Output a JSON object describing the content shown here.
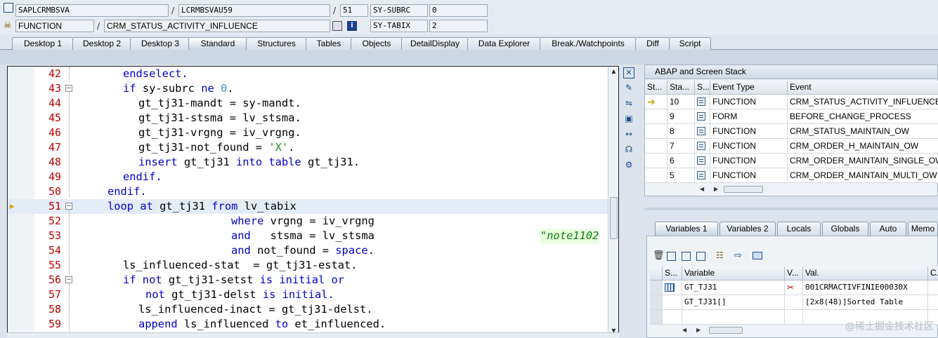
{
  "header": {
    "program": "SAPLCRMBSVA",
    "include": "LCRMBSVAU59",
    "line": "51",
    "sysubrc_label": "SY-SUBRC",
    "sysubrc_value": "0",
    "event_type": "FUNCTION",
    "event": "CRM_STATUS_ACTIVITY_INFLUENCE",
    "sytabix_label": "SY-TABIX",
    "sytabix_value": "2",
    "sep1": "/",
    "sep2": "/"
  },
  "tabs": [
    "Desktop 1",
    "Desktop 2",
    "Desktop 3",
    "Standard",
    "Structures",
    "Tables",
    "Objects",
    "DetailDisplay",
    "Data Explorer",
    "Break./Watchpoints",
    "Diff",
    "Script"
  ],
  "active_tab": "Standard",
  "code": {
    "current_line": "51",
    "lines": [
      {
        "n": "42",
        "t": "endselect."
      },
      {
        "n": "43",
        "t": "if sy-subrc ne 0."
      },
      {
        "n": "44",
        "t": "gt_tj31-mandt = sy-mandt."
      },
      {
        "n": "45",
        "t": "gt_tj31-stsma = lv_stsma."
      },
      {
        "n": "46",
        "t": "gt_tj31-vrgng = iv_vrgng."
      },
      {
        "n": "47",
        "t": "gt_tj31-not_found = 'X'."
      },
      {
        "n": "48",
        "t": "insert gt_tj31 into table gt_tj31."
      },
      {
        "n": "49",
        "t": "endif."
      },
      {
        "n": "50",
        "t": "endif."
      },
      {
        "n": "51",
        "t": "loop at gt_tj31 from lv_tabix"
      },
      {
        "n": "52",
        "t": "where vrgng = iv_vrgng"
      },
      {
        "n": "53",
        "t": "and   stsma = lv_stsma"
      },
      {
        "n": "54",
        "t": "and not_found = space."
      },
      {
        "n": "55",
        "t": "ls_influenced-stat  = gt_tj31-estat."
      },
      {
        "n": "56",
        "t": "if not gt_tj31-setst is initial or"
      },
      {
        "n": "57",
        "t": "not gt_tj31-delst is initial."
      },
      {
        "n": "58",
        "t": "ls_influenced-inact = gt_tj31-delst."
      },
      {
        "n": "59",
        "t": "append ls_influenced to et_influenced."
      }
    ],
    "comment": "\"note1102"
  },
  "stack": {
    "title": "ABAP and Screen Stack",
    "columns": [
      "St...",
      "Sta...",
      "S...",
      "Event Type",
      "Event"
    ],
    "rows": [
      {
        "level": "10",
        "type": "FUNCTION",
        "event": "CRM_STATUS_ACTIVITY_INFLUENCE"
      },
      {
        "level": "9",
        "type": "FORM",
        "event": "BEFORE_CHANGE_PROCESS"
      },
      {
        "level": "8",
        "type": "FUNCTION",
        "event": "CRM_STATUS_MAINTAIN_OW"
      },
      {
        "level": "7",
        "type": "FUNCTION",
        "event": "CRM_ORDER_H_MAINTAIN_OW"
      },
      {
        "level": "6",
        "type": "FUNCTION",
        "event": "CRM_ORDER_MAINTAIN_SINGLE_OW"
      },
      {
        "level": "5",
        "type": "FUNCTION",
        "event": "CRM_ORDER_MAINTAIN_MULTI_OW"
      }
    ]
  },
  "var_tabs": [
    "Variables 1",
    "Variables 2",
    "Locals",
    "Globals",
    "Auto",
    "Memo"
  ],
  "variables": {
    "columns": [
      "S...",
      "Variable",
      "V...",
      "Val.",
      "C..."
    ],
    "rows": [
      {
        "name": "GT_TJ31",
        "value": "001CRMACTIVFINIE00030X"
      },
      {
        "name": "GT_TJ31[]",
        "value": "[2x8(48)]Sorted Table"
      }
    ]
  },
  "watermark": "@稀土掘金技术社区"
}
